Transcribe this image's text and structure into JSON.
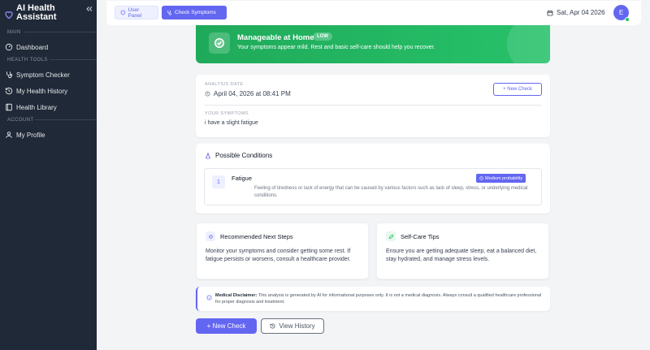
{
  "sidebar": {
    "brand_title": "AI Health Assistant",
    "sections": {
      "main": "MAIN",
      "health_tools": "HEALTH TOOLS",
      "account": "ACCOUNT"
    },
    "items": [
      {
        "label": "Dashboard",
        "icon": "gauge-icon"
      },
      {
        "label": "Symptom Checker",
        "icon": "stethoscope-icon"
      },
      {
        "label": "My Health History",
        "icon": "history-icon"
      },
      {
        "label": "Health Library",
        "icon": "book-icon"
      },
      {
        "label": "My Profile",
        "icon": "user-icon"
      }
    ]
  },
  "header": {
    "user_panel": "User Panel",
    "check_symptoms": "Check Symptoms",
    "date": "Sat, Apr 04 2026",
    "avatar_initial": "E"
  },
  "banner": {
    "title": "Manageable at Home",
    "badge": "LOW",
    "subtitle": "Your symptoms appear mild. Rest and basic self-care should help you recover."
  },
  "analysis": {
    "date_label": "ANALYSIS DATE",
    "date_value": "April 04, 2026 at 08:41 PM",
    "new_check": "+ New Check",
    "symptoms_label": "YOUR SYMPTOMS",
    "symptoms_value": "i have a slight fatigue"
  },
  "conditions": {
    "title": "Possible Conditions",
    "items": [
      {
        "number": "1",
        "name": "Fatigue",
        "probability": "Medium probability",
        "description": "Feeling of tiredness or lack of energy that can be caused by various factors such as lack of sleep, stress, or underlying medical conditions."
      }
    ]
  },
  "next_steps": {
    "title": "Recommended Next Steps",
    "text": "Monitor your symptoms and consider getting some rest. If fatigue persists or worsens, consult a healthcare provider."
  },
  "self_care": {
    "title": "Self-Care Tips",
    "text": "Ensure you are getting adequate sleep, eat a balanced diet, stay hydrated, and manage stress levels."
  },
  "disclaimer": {
    "label": "Medical Disclaimer:",
    "text": " This analysis is generated by AI for informational purposes only. It is not a medical diagnosis. Always consult a qualified healthcare professional for proper diagnosis and treatment."
  },
  "actions": {
    "new_check": "+ New Check",
    "view_history": "View History"
  },
  "colors": {
    "accent": "#6366f1",
    "sidebar_bg": "#1f2937",
    "success": "#22c55e"
  }
}
